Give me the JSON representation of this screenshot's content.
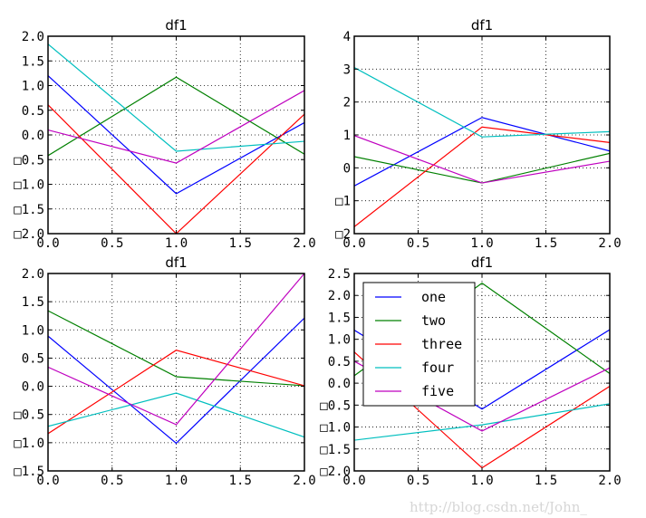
{
  "chart_data": [
    {
      "type": "line",
      "title": "df1",
      "xlabel": "",
      "ylabel": "",
      "x": [
        0,
        1,
        2
      ],
      "xlim": [
        0,
        2
      ],
      "ylim": [
        -2,
        2
      ],
      "xticks": [
        0,
        0.5,
        1,
        1.5,
        2
      ],
      "xtick_labels": [
        "0.0",
        "0.5",
        "1.0",
        "1.5",
        "2.0"
      ],
      "yticks": [
        2,
        1.5,
        1,
        0.5,
        0,
        -0.5,
        -1,
        -1.5,
        -2
      ],
      "ytick_labels": [
        "2.0",
        "1.5",
        "1.0",
        "0.5",
        "0.0",
        "□0.5",
        "□1.0",
        "□1.5",
        "□2.0"
      ],
      "grid": true,
      "legend": false,
      "series": [
        {
          "name": "one",
          "color": "#0000ff",
          "values": [
            1.2,
            -1.19,
            0.25
          ]
        },
        {
          "name": "two",
          "color": "#008000",
          "values": [
            -0.42,
            1.17,
            -0.39
          ]
        },
        {
          "name": "three",
          "color": "#ff0000",
          "values": [
            0.61,
            -2.0,
            0.42
          ]
        },
        {
          "name": "four",
          "color": "#00bfbf",
          "values": [
            1.84,
            -0.33,
            -0.13
          ]
        },
        {
          "name": "five",
          "color": "#bf00bf",
          "values": [
            0.1,
            -0.57,
            0.9
          ]
        }
      ]
    },
    {
      "type": "line",
      "title": "df1",
      "xlabel": "",
      "ylabel": "",
      "x": [
        0,
        1,
        2
      ],
      "xlim": [
        0,
        2
      ],
      "ylim": [
        -2,
        4
      ],
      "xticks": [
        0,
        0.5,
        1,
        1.5,
        2
      ],
      "xtick_labels": [
        "0.0",
        "0.5",
        "1.0",
        "1.5",
        "2.0"
      ],
      "yticks": [
        4,
        3,
        2,
        1,
        0,
        -1,
        -2
      ],
      "ytick_labels": [
        "4",
        "3",
        "2",
        "1",
        "0",
        "□1",
        "□2"
      ],
      "grid": true,
      "legend": false,
      "series": [
        {
          "name": "one",
          "color": "#0000ff",
          "values": [
            -0.55,
            1.53,
            0.51
          ]
        },
        {
          "name": "two",
          "color": "#008000",
          "values": [
            0.34,
            -0.46,
            0.44
          ]
        },
        {
          "name": "three",
          "color": "#ff0000",
          "values": [
            -1.79,
            1.24,
            0.77
          ]
        },
        {
          "name": "four",
          "color": "#00bfbf",
          "values": [
            3.05,
            0.94,
            1.1
          ]
        },
        {
          "name": "five",
          "color": "#bf00bf",
          "values": [
            0.98,
            -0.46,
            0.2
          ]
        }
      ]
    },
    {
      "type": "line",
      "title": "df1",
      "xlabel": "",
      "ylabel": "",
      "x": [
        0,
        1,
        2
      ],
      "xlim": [
        0,
        2
      ],
      "ylim": [
        -1.5,
        2
      ],
      "xticks": [
        0,
        0.5,
        1,
        1.5,
        2
      ],
      "xtick_labels": [
        "0.0",
        "0.5",
        "1.0",
        "1.5",
        "2.0"
      ],
      "yticks": [
        2,
        1.5,
        1,
        0.5,
        0,
        -0.5,
        -1,
        -1.5
      ],
      "ytick_labels": [
        "2.0",
        "1.5",
        "1.0",
        "0.5",
        "0.0",
        "□0.5",
        "□1.0",
        "□1.5"
      ],
      "grid": true,
      "legend": false,
      "series": [
        {
          "name": "one",
          "color": "#0000ff",
          "values": [
            0.89,
            -1.01,
            1.21
          ]
        },
        {
          "name": "two",
          "color": "#008000",
          "values": [
            1.34,
            0.17,
            0.01
          ]
        },
        {
          "name": "three",
          "color": "#ff0000",
          "values": [
            -0.84,
            0.64,
            0.01
          ]
        },
        {
          "name": "four",
          "color": "#00bfbf",
          "values": [
            -0.71,
            -0.12,
            -0.9
          ]
        },
        {
          "name": "five",
          "color": "#bf00bf",
          "values": [
            0.34,
            -0.68,
            2.0
          ]
        }
      ]
    },
    {
      "type": "line",
      "title": "df1",
      "xlabel": "",
      "ylabel": "",
      "x": [
        0,
        1,
        2
      ],
      "xlim": [
        0,
        2
      ],
      "ylim": [
        -2,
        2.5
      ],
      "xticks": [
        0,
        0.5,
        1,
        1.5,
        2
      ],
      "xtick_labels": [
        "0.0",
        "0.5",
        "1.0",
        "1.5",
        "2.0"
      ],
      "yticks": [
        2.5,
        2,
        1.5,
        1,
        0.5,
        0,
        -0.5,
        -1,
        -1.5,
        -2
      ],
      "ytick_labels": [
        "2.5",
        "2.0",
        "1.5",
        "1.0",
        "0.5",
        "0.0",
        "□0.5",
        "□1.0",
        "□1.5",
        "□2.0"
      ],
      "grid": true,
      "legend": true,
      "legend_position": "upper-left",
      "series": [
        {
          "name": "one",
          "color": "#0000ff",
          "values": [
            1.21,
            -0.59,
            1.22
          ]
        },
        {
          "name": "two",
          "color": "#008000",
          "values": [
            0.17,
            2.28,
            0.22
          ]
        },
        {
          "name": "three",
          "color": "#ff0000",
          "values": [
            0.71,
            -1.93,
            -0.07
          ]
        },
        {
          "name": "four",
          "color": "#00bfbf",
          "values": [
            -1.3,
            -0.95,
            -0.47
          ]
        },
        {
          "name": "five",
          "color": "#bf00bf",
          "values": [
            0.5,
            -1.09,
            0.35
          ]
        }
      ]
    }
  ],
  "watermark": "http://blog.csdn.net/John_"
}
